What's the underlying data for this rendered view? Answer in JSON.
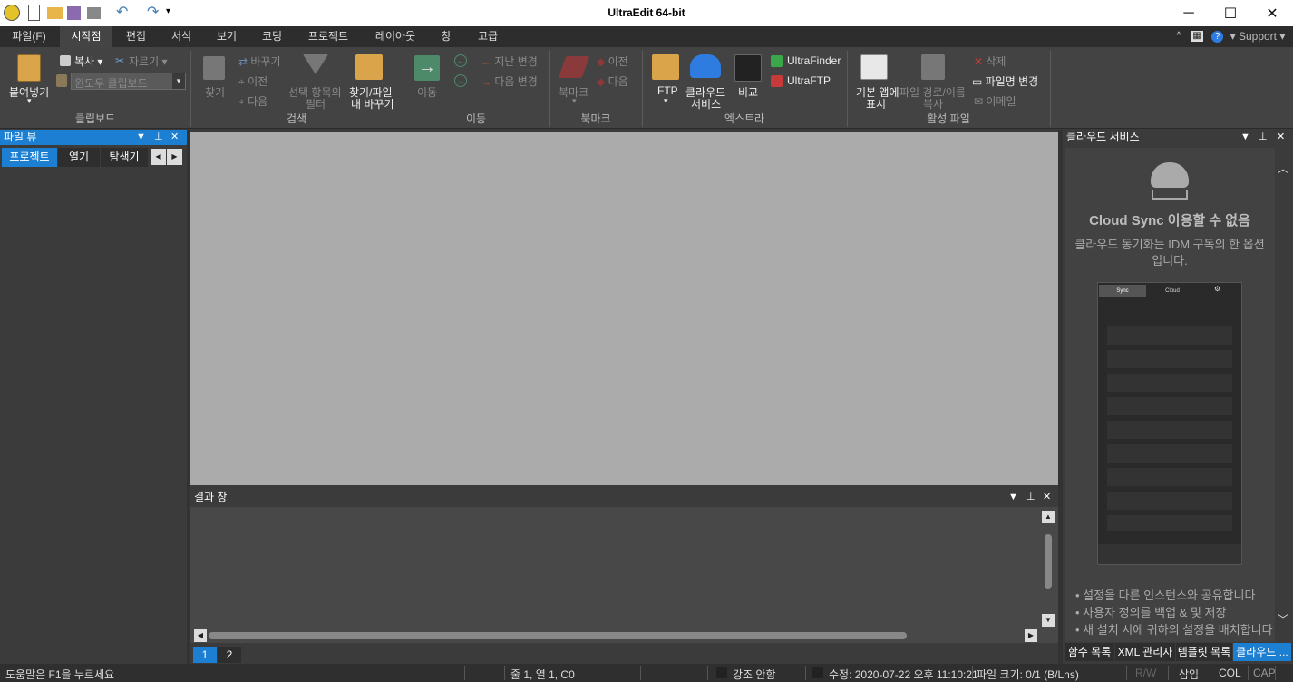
{
  "window": {
    "title": "UltraEdit 64-bit",
    "minimize": "─",
    "maximize": "☐",
    "close": "✕"
  },
  "menu": {
    "tabs": [
      "파일(F)",
      "시작점",
      "편집",
      "서식",
      "보기",
      "코딩",
      "프로젝트",
      "레이아웃",
      "창",
      "고급"
    ],
    "active": "시작점",
    "right": {
      "support": "Support"
    }
  },
  "ribbon": {
    "clipboard": {
      "paste": "붙여넣기",
      "copy": "복사",
      "cut": "자르기",
      "clipboard_select": "윈도우 클립보드",
      "label": "클립보드"
    },
    "search": {
      "find": "찾기",
      "replace": "바꾸기",
      "prev": "이전",
      "next": "다음",
      "filter_l1": "선택 항목의",
      "filter_l2": "필터",
      "findfile_l1": "찾기/파일",
      "findfile_l2": "내 바꾸기",
      "label": "검색"
    },
    "move": {
      "go": "이동",
      "last_change": "지난 변경",
      "next_change": "다음 변경",
      "label": "이동"
    },
    "bookmark": {
      "bookmark": "북마크",
      "prev": "이전",
      "next": "다음",
      "label": "북마크"
    },
    "extra": {
      "ftp": "FTP",
      "cloud_l1": "클라우드",
      "cloud_l2": "서비스",
      "compare": "비교",
      "ultrafinder": "UltraFinder",
      "ultraftp": "UltraFTP",
      "label": "엑스트라"
    },
    "active": {
      "default_l1": "기본 앱에",
      "default_l2": "표시",
      "copy_path_l1": "파일 경로/이름",
      "copy_path_l2": "복사",
      "delete": "삭제",
      "rename": "파일명 변경",
      "email": "이메일",
      "label": "활성 파일"
    }
  },
  "file_view": {
    "title": "파일 뷰",
    "tabs": [
      "프로젝트",
      "열기",
      "탐색기"
    ]
  },
  "results": {
    "title": "결과 창",
    "tabs": [
      "1",
      "2"
    ]
  },
  "cloud": {
    "title": "클라우드 서비스",
    "heading": "Cloud Sync 이용할 수 없음",
    "desc": "클라우드 동기화는 IDM 구독의 한 옵션입니다.",
    "preview_tabs": [
      "Sync",
      "Cloud"
    ],
    "bullets": [
      "설정을 다른 인스턴스와 공유합니다",
      "사용자 정의를 백업 & 및 저장",
      "새 설치 시에 귀하의 설정을 배치합니다"
    ],
    "bottom_tabs": [
      "함수 목록",
      "XML 관리자",
      "템플릿 목록",
      "클라우드 ..."
    ]
  },
  "status": {
    "help": "도움말은 F1을 누르세요",
    "position": "줄 1, 열 1, C0",
    "highlight": "강조 안함",
    "modified": "수정: 2020-07-22 오후 11:10:21",
    "filesize": "파일 크기: 0/1 (B/Lns)",
    "rw": "R/W",
    "insert": "삽입",
    "col": "COL",
    "cap": "CAP"
  },
  "colors": {
    "accent": "#1c7fd1",
    "editor_bg": "#ababab",
    "panel_bg": "#3b3b3b"
  }
}
